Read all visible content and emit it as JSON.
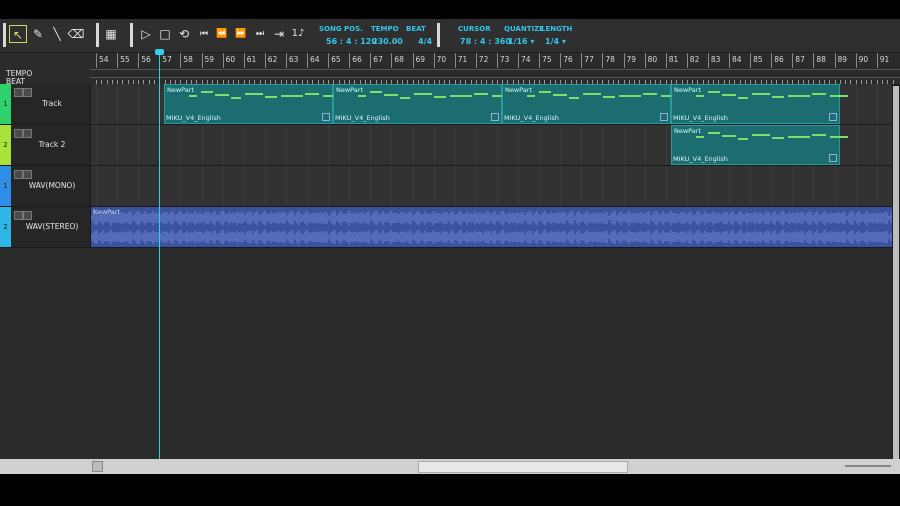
{
  "toolbar": {
    "tools": [
      {
        "name": "select-tool-icon",
        "glyph": "↖",
        "selected": true
      },
      {
        "name": "pencil-tool-icon",
        "glyph": "✎"
      },
      {
        "name": "line-tool-icon",
        "glyph": "╲"
      },
      {
        "name": "eraser-tool-icon",
        "glyph": "⌫"
      },
      {
        "name": "mixer-icon",
        "glyph": "▦"
      },
      {
        "name": "play-icon",
        "glyph": "▷"
      },
      {
        "name": "stop-icon",
        "glyph": "□"
      },
      {
        "name": "loop-icon",
        "glyph": "⟲"
      },
      {
        "name": "go-start-icon",
        "glyph": "⏮"
      },
      {
        "name": "rewind-icon",
        "glyph": "⏪"
      },
      {
        "name": "fast-forward-icon",
        "glyph": "⏩"
      },
      {
        "name": "go-end-icon",
        "glyph": "⏭"
      },
      {
        "name": "auto-scroll-icon",
        "glyph": "⇥"
      },
      {
        "name": "metronome-icon",
        "glyph": "1♪"
      }
    ],
    "song_pos_label": "SONG POS.",
    "song_pos": "56 : 4 : 120",
    "tempo_label": "TEMPO",
    "tempo": "230.00",
    "beat_label": "BEAT",
    "beat": "4/4",
    "cursor_label": "CURSOR",
    "cursor": "78 : 4 : 360",
    "quantize_label": "QUANTIZE",
    "quantize": "1/16 ▾",
    "length_label": "LENGTH",
    "length": "1/4 ▾"
  },
  "ruler": {
    "tempo_label": "TEMPO",
    "beat_label": "BEAT",
    "bars": [
      "54",
      "55",
      "56",
      "57",
      "58",
      "59",
      "60",
      "61",
      "62",
      "63",
      "64",
      "65",
      "66",
      "67",
      "68",
      "69",
      "70",
      "71",
      "72",
      "73",
      "74",
      "75",
      "76",
      "77",
      "78",
      "79",
      "80",
      "81",
      "82",
      "83",
      "84",
      "85",
      "86",
      "87",
      "88",
      "89",
      "90",
      "91"
    ]
  },
  "tracks": [
    {
      "number": "1",
      "name": "Track",
      "color": "#2ed16a",
      "type": "vocal"
    },
    {
      "number": "2",
      "name": "Track 2",
      "color": "#a8e23a",
      "type": "vocal"
    },
    {
      "number": "1",
      "name": "WAV(MONO)",
      "color": "#2f8ee8",
      "type": "wav"
    },
    {
      "number": "2",
      "name": "WAV(STEREO)",
      "color": "#2fb6e8",
      "type": "wav"
    }
  ],
  "parts": {
    "vocal_name": "NewPart",
    "singer": "MIKU_V4_English",
    "wav_name": "NewPart"
  },
  "colors": {
    "accent": "#34c6e8",
    "part": "#1c6d70",
    "note": "#7ae06a",
    "wave": "#3a52a0"
  }
}
